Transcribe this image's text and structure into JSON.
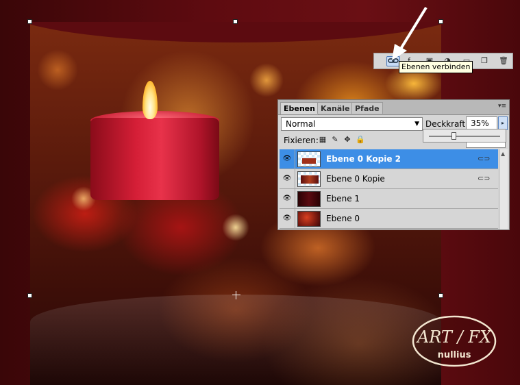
{
  "toolbar": {
    "icons": [
      "link-layers-icon",
      "style-icon",
      "mask-icon",
      "adjustment-icon",
      "group-icon",
      "new-layer-icon",
      "trash-icon"
    ],
    "tooltip": "Ebenen verbinden"
  },
  "layers_panel": {
    "tabs": [
      {
        "label": "Ebenen",
        "active": true
      },
      {
        "label": "Kanäle",
        "active": false
      },
      {
        "label": "Pfade",
        "active": false
      }
    ],
    "blend_mode": "Normal",
    "opacity_label": "Deckkraft:",
    "opacity_value": "35%",
    "opacity_slider_fraction": 0.35,
    "lock_label": "Fixieren:",
    "layers": [
      {
        "name": "Ebene 0 Kopie 2",
        "selected": true,
        "linked": true,
        "visible": true
      },
      {
        "name": "Ebene 0 Kopie",
        "selected": false,
        "linked": true,
        "visible": true
      },
      {
        "name": "Ebene 1",
        "selected": false,
        "linked": false,
        "visible": true
      },
      {
        "name": "Ebene 0",
        "selected": false,
        "linked": false,
        "visible": true
      }
    ]
  },
  "watermark": {
    "text_top": "ART / FX",
    "text_bottom": "nullius"
  },
  "colors": {
    "selection": "#3d8ee6",
    "panel": "#d6d6d6",
    "background": "#5e0b10"
  }
}
